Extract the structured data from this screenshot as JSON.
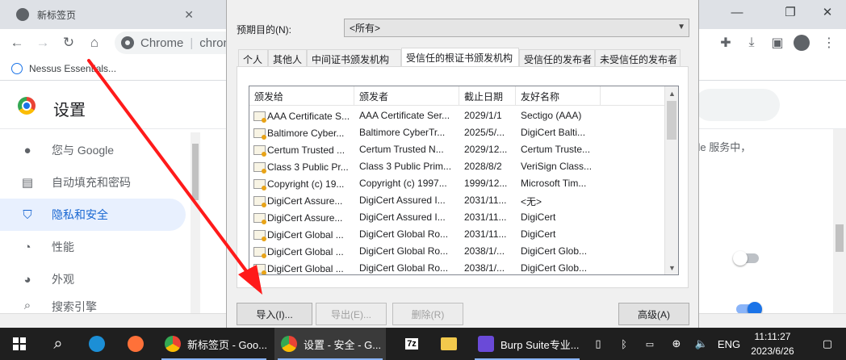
{
  "browser": {
    "tabs": [
      {
        "title": "新标签页"
      },
      {
        "title": ""
      }
    ],
    "window_controls": {
      "minimize": "—",
      "restore": "❐",
      "close": "✕"
    },
    "omnibox": {
      "site": "Chrome",
      "url_fragment": "chron"
    },
    "bookmark": {
      "label": "Nessus Essentials..."
    },
    "settings_title": "设置"
  },
  "sidebar": {
    "items": [
      {
        "label": "您与 Google",
        "icon": "person-icon"
      },
      {
        "label": "自动填充和密码",
        "icon": "clipboard-icon"
      },
      {
        "label": "隐私和安全",
        "icon": "shield-icon",
        "active": true
      },
      {
        "label": "性能",
        "icon": "gauge-icon"
      },
      {
        "label": "外观",
        "icon": "palette-icon"
      },
      {
        "label": "搜索引擎",
        "icon": "search-icon"
      }
    ]
  },
  "main": {
    "partial_text": "ogle 服务中，"
  },
  "dialog": {
    "purpose_label": "预期目的(N):",
    "purpose_value": "<所有>",
    "tabs": [
      "个人",
      "其他人",
      "中间证书颁发机构",
      "受信任的根证书颁发机构",
      "受信任的发布者",
      "未受信任的发布者"
    ],
    "selected_tab": "受信任的根证书颁发机构",
    "columns": [
      "颁发给",
      "颁发者",
      "截止日期",
      "友好名称"
    ],
    "rows": [
      {
        "issued_to": "AAA Certificate S...",
        "issued_by": "AAA Certificate Ser...",
        "expires": "2029/1/1",
        "friendly": "Sectigo (AAA)"
      },
      {
        "issued_to": "Baltimore Cyber...",
        "issued_by": "Baltimore CyberTr...",
        "expires": "2025/5/...",
        "friendly": "DigiCert Balti..."
      },
      {
        "issued_to": "Certum Trusted ...",
        "issued_by": "Certum Trusted N...",
        "expires": "2029/12...",
        "friendly": "Certum Truste..."
      },
      {
        "issued_to": "Class 3 Public Pr...",
        "issued_by": "Class 3 Public Prim...",
        "expires": "2028/8/2",
        "friendly": "VeriSign Class..."
      },
      {
        "issued_to": "Copyright (c) 19...",
        "issued_by": "Copyright (c) 1997...",
        "expires": "1999/12...",
        "friendly": "Microsoft Tim..."
      },
      {
        "issued_to": "DigiCert Assure...",
        "issued_by": "DigiCert Assured I...",
        "expires": "2031/11...",
        "friendly": "<无>"
      },
      {
        "issued_to": "DigiCert Assure...",
        "issued_by": "DigiCert Assured I...",
        "expires": "2031/11...",
        "friendly": "DigiCert"
      },
      {
        "issued_to": "DigiCert Global ...",
        "issued_by": "DigiCert Global Ro...",
        "expires": "2031/11...",
        "friendly": "DigiCert"
      },
      {
        "issued_to": "DigiCert Global ...",
        "issued_by": "DigiCert Global Ro...",
        "expires": "2038/1/...",
        "friendly": "DigiCert Glob..."
      },
      {
        "issued_to": "DigiCert Global ...",
        "issued_by": "DigiCert Global Ro...",
        "expires": "2038/1/...",
        "friendly": "DigiCert Glob..."
      }
    ],
    "buttons": {
      "import": "导入(I)...",
      "export": "导出(E)...",
      "remove": "删除(R)",
      "advanced": "高级(A)"
    }
  },
  "annotation": {
    "color": "#ff1a1a"
  },
  "taskbar": {
    "apps": [
      {
        "label": "新标签页 - Goo...",
        "icon": "chrome-icon"
      },
      {
        "label": "设置 - 安全 - G...",
        "icon": "chrome-icon",
        "active": true
      },
      {
        "label": "Burp Suite专业...",
        "icon": "burp-icon"
      }
    ],
    "language": "ENG",
    "time": "11:11:27",
    "date": "2023/6/26"
  },
  "colors": {
    "accent": "#1a73e8",
    "active_nav_bg": "#e8f0fe",
    "taskbar": "#1f1f1f"
  }
}
